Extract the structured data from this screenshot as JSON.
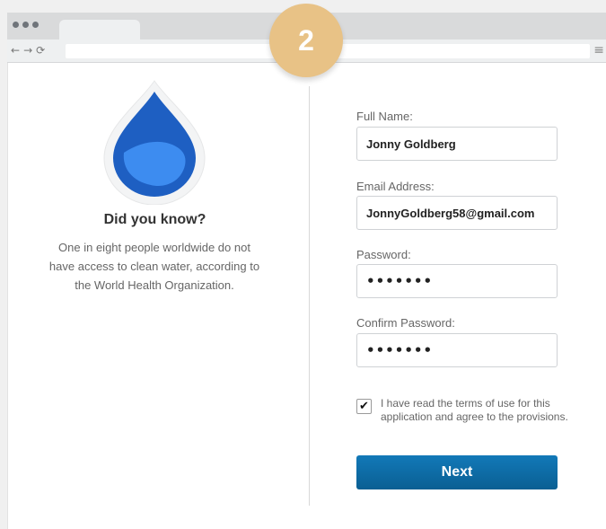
{
  "step_badge": "2",
  "info": {
    "heading": "Did you know?",
    "fact": "One in eight people worldwide do not have access to clean water, according to the World Health Organization."
  },
  "form": {
    "full_name_label": "Full Name:",
    "full_name_value": "Jonny Goldberg",
    "email_label": "Email Address:",
    "email_value": "JonnyGoldberg58@gmail.com",
    "password_label": "Password:",
    "password_value": "•••••••",
    "confirm_label": "Confirm Password:",
    "confirm_value": "•••••••",
    "terms_checked": true,
    "terms_text": "I have read the terms of use for this application and agree to the provisions.",
    "next_label": "Next"
  },
  "icons": {
    "check": "✔",
    "back": "←",
    "forward": "→",
    "reload": "⟳",
    "menu": "≡"
  },
  "colors": {
    "badge": "#e8c286",
    "drop_dark": "#1e5fc2",
    "drop_light": "#3d8cf0",
    "button": "#0a6ba8"
  }
}
